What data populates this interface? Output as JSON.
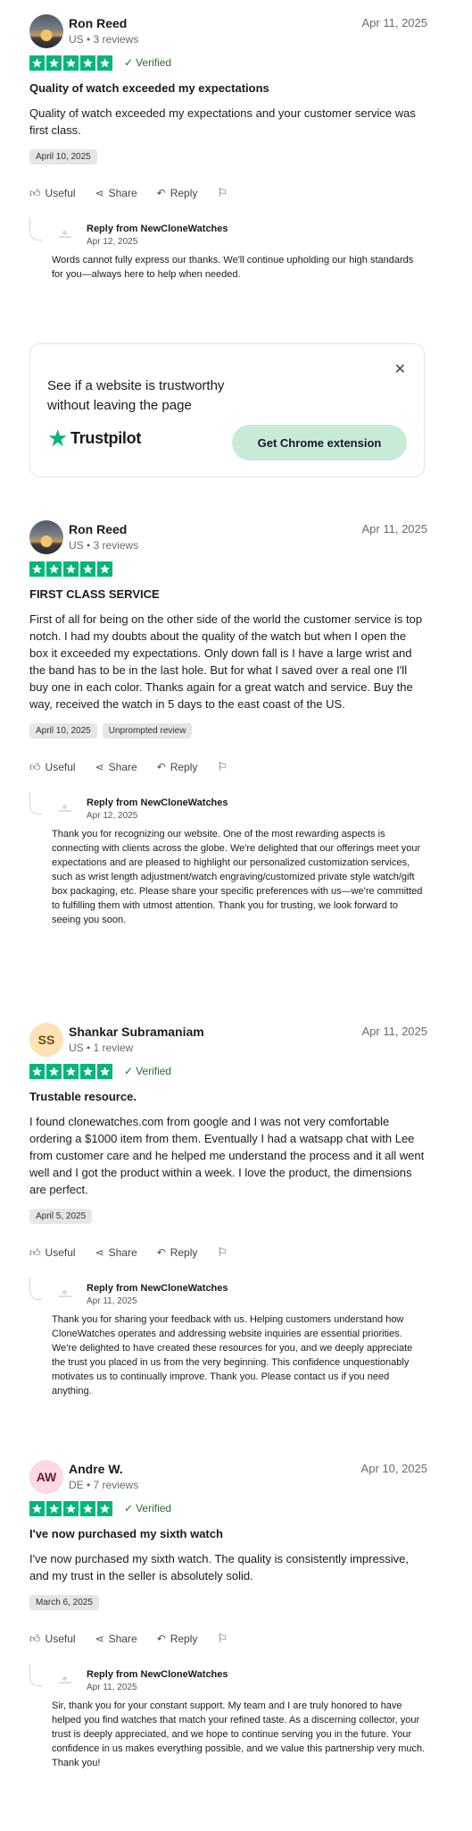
{
  "reviews": [
    {
      "name": "Ron Reed",
      "meta": "US • 3 reviews",
      "date": "Apr 11, 2025",
      "verified": "Verified",
      "title": "Quality of watch exceeded my expectations",
      "body": "Quality of watch exceeded my expectations and your customer service was first class.",
      "tags": [
        "April 10, 2025"
      ],
      "rating": 5,
      "reply": {
        "from": "Reply from NewCloneWatches",
        "date": "Apr 12, 2025",
        "text": "Words cannot fully express our thanks. We'll continue upholding our high standards for you—always here to help when needed."
      }
    },
    {
      "name": "Ron Reed",
      "meta": "US • 3 reviews",
      "date": "Apr 11, 2025",
      "verified": "",
      "title": "FIRST CLASS SERVICE",
      "body": "First of all for being on the other side of the world the customer service is top notch. I had my doubts about the quality of the watch but when I open the box it exceeded my expectations. Only down fall is I have a large wrist and the band has to be in the last hole. But for what I saved over a real one I'll buy one in each color. Thanks again for a great watch and service. Buy the way, received the watch in 5 days to the east coast of the US.",
      "tags": [
        "April 10, 2025",
        "Unprompted review"
      ],
      "rating": 5,
      "reply": {
        "from": "Reply from NewCloneWatches",
        "date": "Apr 12, 2025",
        "text": "Thank you for recognizing our website. One of the most rewarding aspects is connecting with clients across the globe. We're delighted that our offerings meet your expectations and are pleased to highlight our personalized customization services, such as wrist length adjustment/watch engraving/customized private style watch/gift box packaging, etc. Please share your specific preferences with us—we're committed to fulfilling them with utmost attention. Thank you for trusting, we look forward to seeing you soon."
      }
    },
    {
      "name": "Shankar Subramaniam",
      "initials": "SS",
      "meta": "US • 1 review",
      "date": "Apr 11, 2025",
      "verified": "Verified",
      "title": "Trustable resource.",
      "body": "I found clonewatches.com from google and I was not very comfortable ordering a $1000 item from them. Eventually I had a watsapp chat with Lee from customer care and he helped me understand the process and it all went well and I got the product within a week. I love the product, the dimensions are perfect.",
      "tags": [
        "April 5, 2025"
      ],
      "rating": 5,
      "reply": {
        "from": "Reply from NewCloneWatches",
        "date": "Apr 11, 2025",
        "text": "Thank you for sharing your feedback with us. Helping customers understand how CloneWatches operates and addressing website inquiries are essential priorities. We're delighted to have created these resources for you, and we deeply appreciate the trust you placed in us from the very beginning. This confidence unquestionably motivates us to continually improve. Thank you. Please contact us if you need anything."
      }
    },
    {
      "name": "Andre W.",
      "initials": "AW",
      "meta": "DE • 7 reviews",
      "date": "Apr 10, 2025",
      "verified": "Verified",
      "title": "I've now purchased my sixth watch",
      "body": "I've now purchased my sixth watch. The quality is consistently impressive, and my trust in the seller is absolutely solid.",
      "tags": [
        "March 6, 2025"
      ],
      "rating": 5,
      "reply": {
        "from": "Reply from NewCloneWatches",
        "date": "Apr 11, 2025",
        "text": "Sir, thank you for your constant support. My team and I are truly honored to have helped you find watches that match your refined taste. As a discerning collector, your trust is deeply appreciated, and we hope to continue serving you in the future. Your confidence in us makes everything possible, and we value this partnership very much. Thank you!"
      }
    }
  ],
  "actions": {
    "useful": "Useful",
    "share": "Share",
    "reply": "Reply"
  },
  "promo": {
    "line1": "See if a website is trustworthy",
    "line2": "without leaving the page",
    "brand": "Trustpilot",
    "button": "Get Chrome extension"
  },
  "icons": {
    "useful": "thumbs-up-icon",
    "share": "share-icon",
    "reply": "reply-arrow-icon",
    "flag": "flag-icon",
    "close": "close-icon",
    "star": "star-icon",
    "check": "check-icon"
  },
  "colors": {
    "star_green": "#00b67a",
    "button_bg": "#c7ebd7",
    "avatar_ss": "#fde3b3",
    "avatar_aw": "#fbd9e2"
  }
}
